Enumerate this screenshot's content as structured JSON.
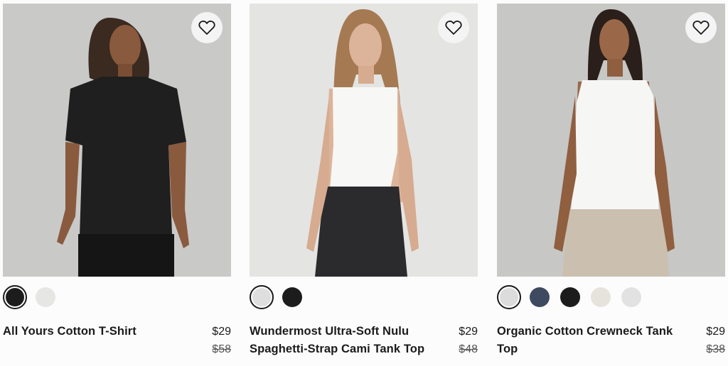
{
  "products": [
    {
      "name": "All Yours Cotton T-Shirt",
      "price": "$29",
      "original_price": "$58",
      "swatches": [
        {
          "color": "#1c1c1c",
          "selected": true
        },
        {
          "color": "#e6e6e4",
          "selected": false
        }
      ]
    },
    {
      "name": "Wundermost Ultra-Soft Nulu Spaghetti-Strap Cami Tank Top",
      "price": "$29",
      "original_price": "$48",
      "swatches": [
        {
          "color": "#dedede",
          "selected": true
        },
        {
          "color": "#1c1c1c",
          "selected": false
        }
      ]
    },
    {
      "name": "Organic Cotton Crewneck Tank Top",
      "price": "$29",
      "original_price": "$38",
      "swatches": [
        {
          "color": "#dcdcdc",
          "selected": true
        },
        {
          "color": "#3d4a5f",
          "selected": false
        },
        {
          "color": "#1c1c1c",
          "selected": false
        },
        {
          "color": "#e6e3dc",
          "selected": false
        },
        {
          "color": "#e2e2e2",
          "selected": false
        }
      ]
    }
  ],
  "icons": {
    "wishlist": "heart-outline-icon"
  }
}
